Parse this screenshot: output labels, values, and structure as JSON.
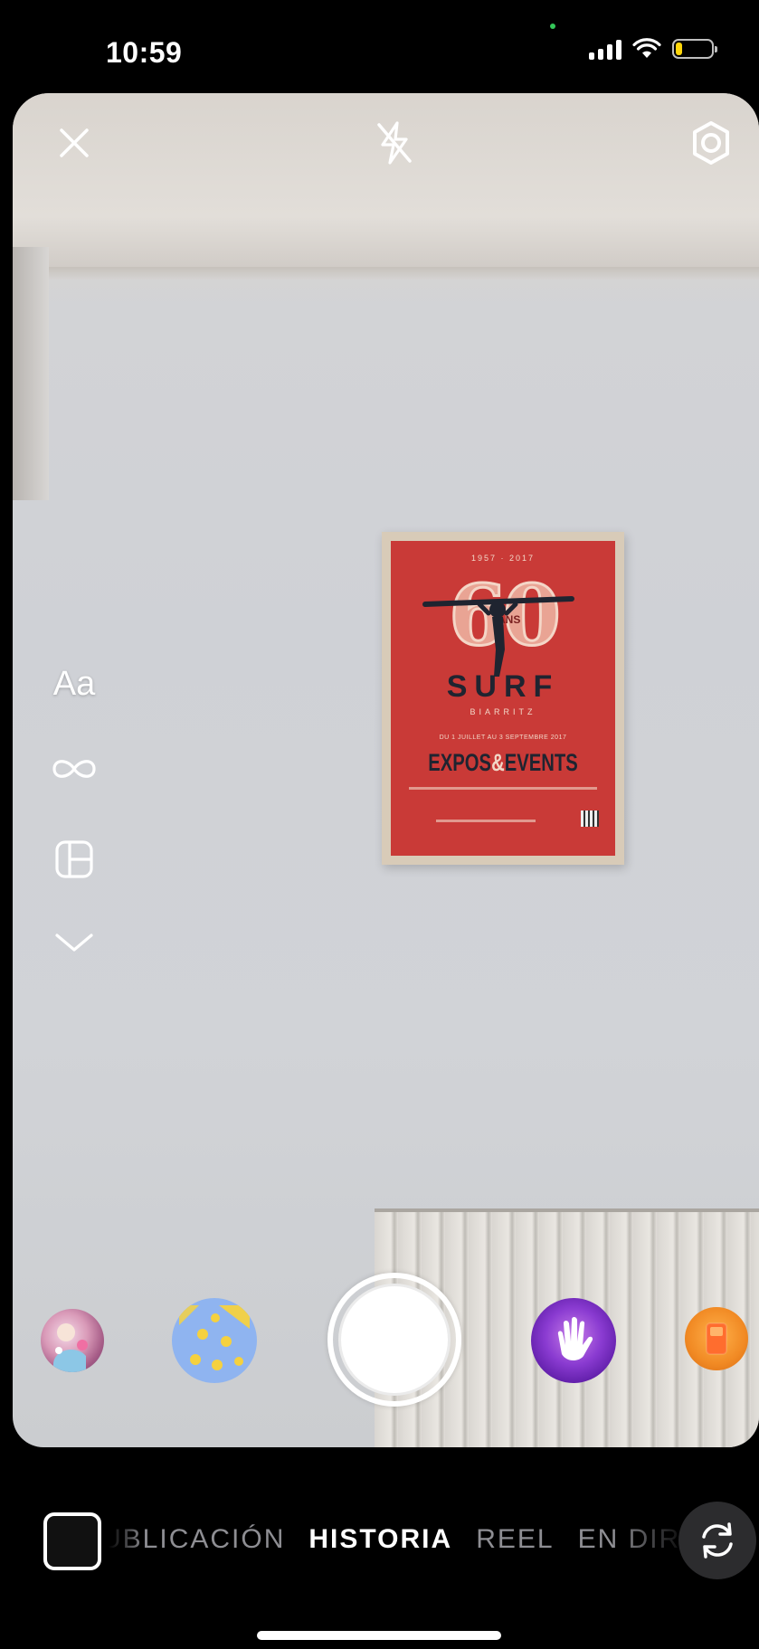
{
  "status_bar": {
    "time": "10:59",
    "battery_level": 0.2,
    "battery_color": "#ffd60a",
    "privacy_dot_color": "#34c759"
  },
  "top_bar": {
    "close_icon": "close-icon",
    "flash_icon": "flash-off-icon",
    "settings_icon": "settings-icon"
  },
  "side_tools": {
    "text_label": "Aa",
    "boomerang_icon": "infinity-icon",
    "layout_icon": "layout-icon",
    "more_icon": "chevron-down-icon"
  },
  "poster": {
    "top_text": "1957 · 2017",
    "big_number": "60",
    "years": "ANS",
    "title": "SURF",
    "subtitle": "BIARRITZ",
    "dates": "DU 1 JUILLET AU 3 SEPTEMBRE 2017",
    "headline_left": "EXPOS",
    "headline_amp": "&",
    "headline_right": "EVENTS"
  },
  "effects": [
    {
      "name": "effect-avatar",
      "icon": "avatar-effect-icon"
    },
    {
      "name": "effect-flowers",
      "icon": "flower-effect-icon"
    },
    {
      "name": "effect-hand",
      "icon": "hand-effect-icon"
    },
    {
      "name": "effect-orange",
      "icon": "orange-effect-icon"
    }
  ],
  "bottom_bar": {
    "modes": [
      "PUBLICACIÓN",
      "HISTORIA",
      "REEL",
      "EN DIRECTO"
    ],
    "active_mode": "HISTORIA",
    "flip_icon": "camera-flip-icon"
  },
  "colors": {
    "background": "#000000",
    "poster_red": "#c93a37",
    "inactive_mode": "#8e8e93",
    "active_mode": "#ffffff"
  }
}
